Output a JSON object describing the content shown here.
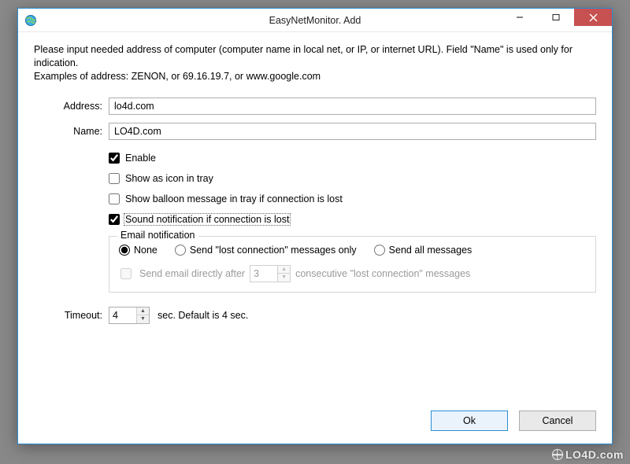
{
  "window": {
    "title": "EasyNetMonitor. Add"
  },
  "instructions": {
    "line1": "Please input needed address of computer (computer name in local net, or IP, or internet URL). Field \"Name\" is used only for indication.",
    "line2": "Examples of address:   ZENON, or  69.16.19.7,  or www.google.com"
  },
  "fields": {
    "address_label": "Address:",
    "address_value": "lo4d.com",
    "name_label": "Name:",
    "name_value": "LO4D.com"
  },
  "options": {
    "enable": {
      "label": "Enable",
      "checked": true
    },
    "tray_icon": {
      "label": "Show as icon in tray",
      "checked": false
    },
    "balloon": {
      "label": "Show balloon message in tray if connection is lost",
      "checked": false
    },
    "sound": {
      "label": "Sound notification if connection is lost",
      "checked": true
    }
  },
  "email": {
    "legend": "Email notification",
    "none_label": "None",
    "lost_only_label": "Send \"lost connection\" messages only",
    "all_label": "Send all messages",
    "selected": "none",
    "after_prefix": "Send email directly after",
    "after_value": "3",
    "after_suffix": "consecutive \"lost connection\" messages",
    "after_checked": false
  },
  "timeout": {
    "label": "Timeout:",
    "value": "4",
    "suffix": "sec. Default is 4 sec."
  },
  "buttons": {
    "ok": "Ok",
    "cancel": "Cancel"
  },
  "watermark": "LO4D.com"
}
